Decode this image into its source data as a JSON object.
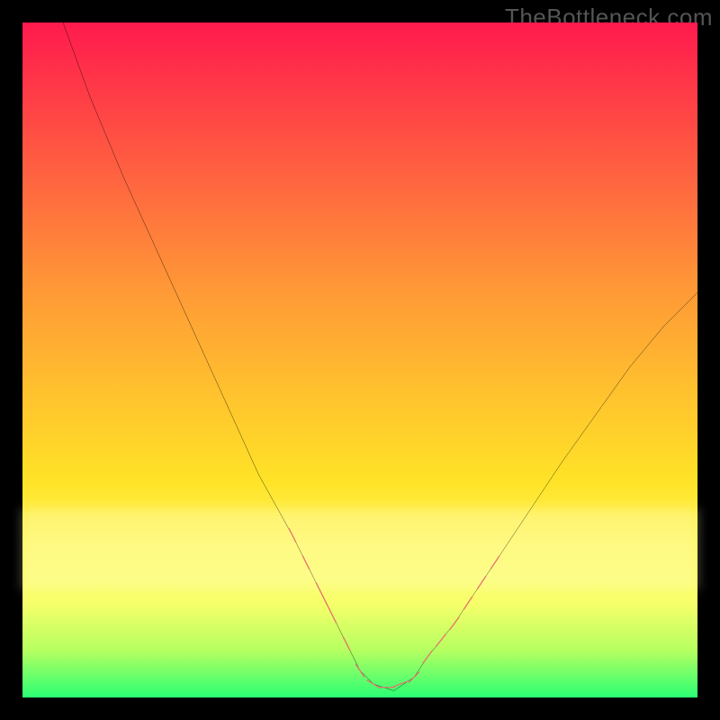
{
  "watermark": "TheBottleneck.com",
  "colors": {
    "background": "#000000",
    "gradient_top": "#ff1a4d",
    "gradient_bottom": "#2aff74",
    "curve": "#000000",
    "markers": "#e5736e"
  },
  "chart_data": {
    "type": "line",
    "title": "",
    "xlabel": "",
    "ylabel": "",
    "xlim": [
      0,
      100
    ],
    "ylim": [
      0,
      100
    ],
    "series": [
      {
        "name": "curve",
        "x": [
          6,
          10,
          15,
          20,
          25,
          30,
          35,
          40,
          45,
          48,
          50,
          52,
          55,
          58,
          60,
          64,
          68,
          72,
          76,
          80,
          85,
          90,
          95,
          100
        ],
        "y": [
          100,
          89,
          77,
          66,
          55,
          44,
          33,
          24,
          14,
          8,
          4,
          2,
          1,
          3,
          6,
          11,
          17,
          23,
          29,
          35,
          42,
          49,
          55,
          60
        ]
      }
    ],
    "markers": [
      {
        "x": 40,
        "y": 24
      },
      {
        "x": 42,
        "y": 20
      },
      {
        "x": 44,
        "y": 16
      },
      {
        "x": 45,
        "y": 14
      },
      {
        "x": 46,
        "y": 12
      },
      {
        "x": 48,
        "y": 8
      },
      {
        "x": 50,
        "y": 4
      },
      {
        "x": 52,
        "y": 2
      },
      {
        "x": 54,
        "y": 1.5
      },
      {
        "x": 56,
        "y": 2
      },
      {
        "x": 58,
        "y": 3
      },
      {
        "x": 60,
        "y": 6
      },
      {
        "x": 62,
        "y": 8.5
      },
      {
        "x": 64,
        "y": 11
      },
      {
        "x": 66,
        "y": 14
      },
      {
        "x": 68,
        "y": 17
      },
      {
        "x": 70,
        "y": 20
      }
    ]
  }
}
